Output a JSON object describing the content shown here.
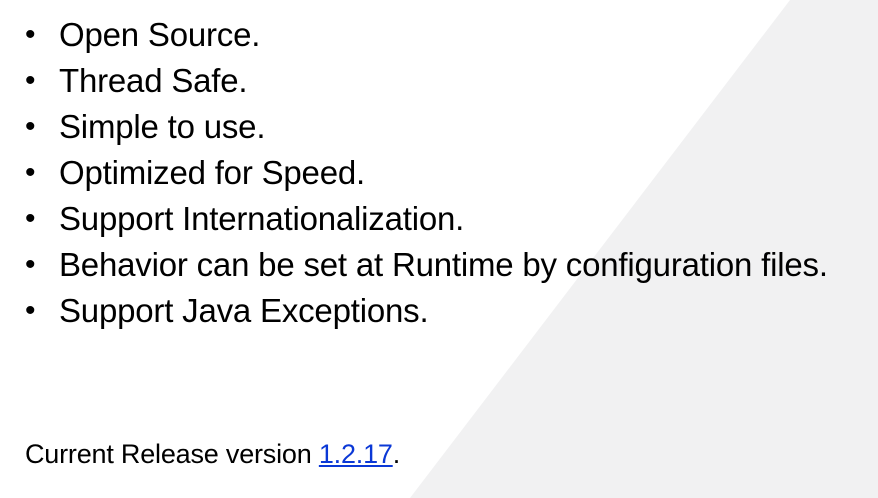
{
  "colors": {
    "background": "#ffffff",
    "diagonal_panel": "#f1f1f2",
    "text": "#000000",
    "link": "#0b38d6"
  },
  "bullet_symbol": "•",
  "features": [
    "Open Source.",
    "Thread Safe.",
    "Simple to use.",
    "Optimized for Speed.",
    "Support Internationalization.",
    "Behavior can be set at Runtime by configuration files.",
    "Support Java Exceptions."
  ],
  "release": {
    "prefix": "Current Release version ",
    "version_link": "1.2.17",
    "suffix": "."
  }
}
